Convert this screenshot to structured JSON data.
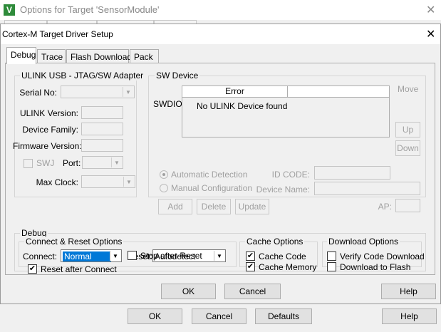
{
  "background_window": {
    "title": "Options for Target 'SensorModule'",
    "logo": "V",
    "buttons": {
      "ok": "OK",
      "cancel": "Cancel",
      "defaults": "Defaults",
      "help": "Help"
    }
  },
  "dialog": {
    "title": "Cortex-M Target Driver Setup",
    "tabs": [
      {
        "label": "Debug",
        "active": true
      },
      {
        "label": "Trace",
        "active": false
      },
      {
        "label": "Flash Download",
        "active": false
      },
      {
        "label": "Pack",
        "active": false
      }
    ],
    "ulink_group": {
      "title": "ULINK USB - JTAG/SW Adapter",
      "serial_no_label": "Serial No:",
      "serial_no_value": "",
      "ulink_version_label": "ULINK Version:",
      "device_family_label": "Device Family:",
      "firmware_version_label": "Firmware Version:",
      "swj_label": "SWJ",
      "swj_checked": false,
      "port_label": "Port:",
      "port_value": "",
      "max_clock_label": "Max Clock:",
      "max_clock_value": ""
    },
    "sw_device": {
      "title": "SW Device",
      "swdio_label": "SWDIO",
      "columns": [
        "Error",
        ""
      ],
      "rows": [
        {
          "text": "No ULINK Device found"
        }
      ],
      "move_label": "Move",
      "up_label": "Up",
      "down_label": "Down",
      "automatic_detection_label": "Automatic Detection",
      "manual_configuration_label": "Manual Configuration",
      "selected_mode": "Automatic Detection",
      "id_code_label": "ID CODE:",
      "device_name_label": "Device Name:",
      "add_label": "Add",
      "delete_label": "Delete",
      "update_label": "Update",
      "ap_label": "AP:"
    },
    "debug_group": {
      "title": "Debug",
      "connect_reset": {
        "title": "Connect & Reset Options",
        "connect_label": "Connect:",
        "connect_value": "Normal",
        "reset_label": "Reset:",
        "reset_value": "Autodetect",
        "reset_after_connect_label": "Reset after Connect",
        "reset_after_connect_checked": true,
        "stop_after_reset_label": "Stop after Reset",
        "stop_after_reset_checked": false
      },
      "cache_options": {
        "title": "Cache Options",
        "cache_code_label": "Cache Code",
        "cache_code_checked": true,
        "cache_memory_label": "Cache Memory",
        "cache_memory_checked": true
      },
      "download_options": {
        "title": "Download Options",
        "verify_code_download_label": "Verify Code Download",
        "verify_code_download_checked": false,
        "download_to_flash_label": "Download to Flash",
        "download_to_flash_checked": false
      }
    },
    "buttons": {
      "ok": "OK",
      "cancel": "Cancel",
      "help": "Help"
    }
  },
  "colors": {
    "selection": "#0078d7",
    "logo": "#2e8b3a"
  }
}
